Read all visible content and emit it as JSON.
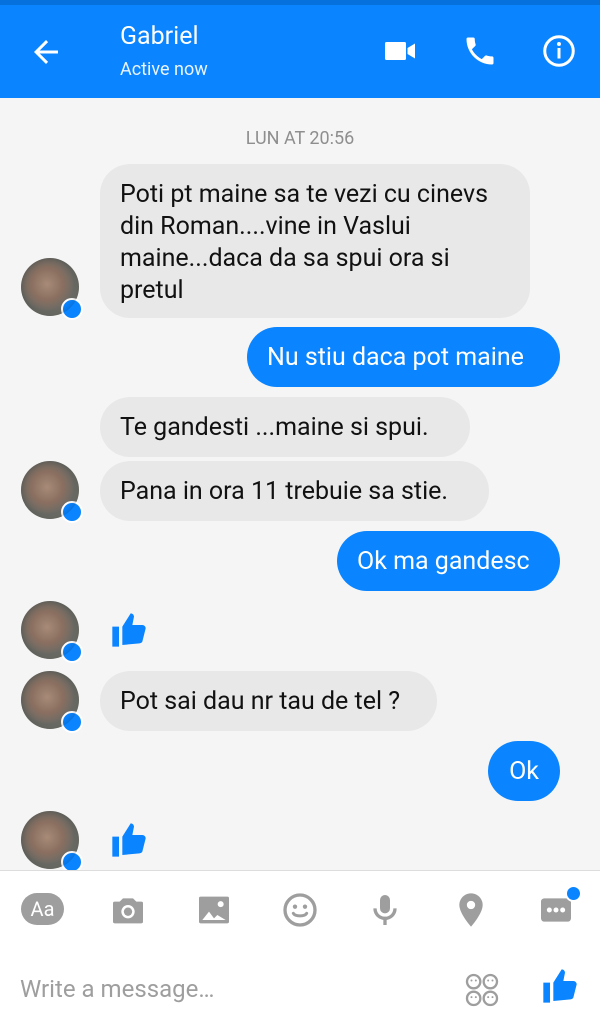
{
  "header": {
    "contact_name": "Gabriel",
    "status": "Active now"
  },
  "chat": {
    "timestamp": "LUN AT 20:56",
    "messages": [
      {
        "from": "contact",
        "text": "Poti pt maine sa te vezi cu cinevs din Roman....vine in Vaslui maine...daca da sa spui ora si pretul"
      },
      {
        "from": "me",
        "text": "Nu stiu daca pot maine"
      },
      {
        "from": "contact",
        "text": "Te gandesti ...maine si spui."
      },
      {
        "from": "contact",
        "text": "Pana in ora 11 trebuie sa stie."
      },
      {
        "from": "me",
        "text": "Ok ma gandesc"
      },
      {
        "from": "contact",
        "type": "like"
      },
      {
        "from": "contact",
        "text": "Pot sai dau nr tau de tel ?"
      },
      {
        "from": "me",
        "text": "Ok"
      },
      {
        "from": "contact",
        "type": "like"
      }
    ]
  },
  "composer": {
    "aa_label": "Aa",
    "placeholder": "Write a message…",
    "toolbar_icons": [
      "camera-icon",
      "gallery-icon",
      "emoji-icon",
      "microphone-icon",
      "location-icon",
      "more-icon"
    ]
  },
  "colors": {
    "accent": "#0a84ff",
    "incoming_bubble": "#e8e8e8",
    "background": "#f5f5f5"
  }
}
